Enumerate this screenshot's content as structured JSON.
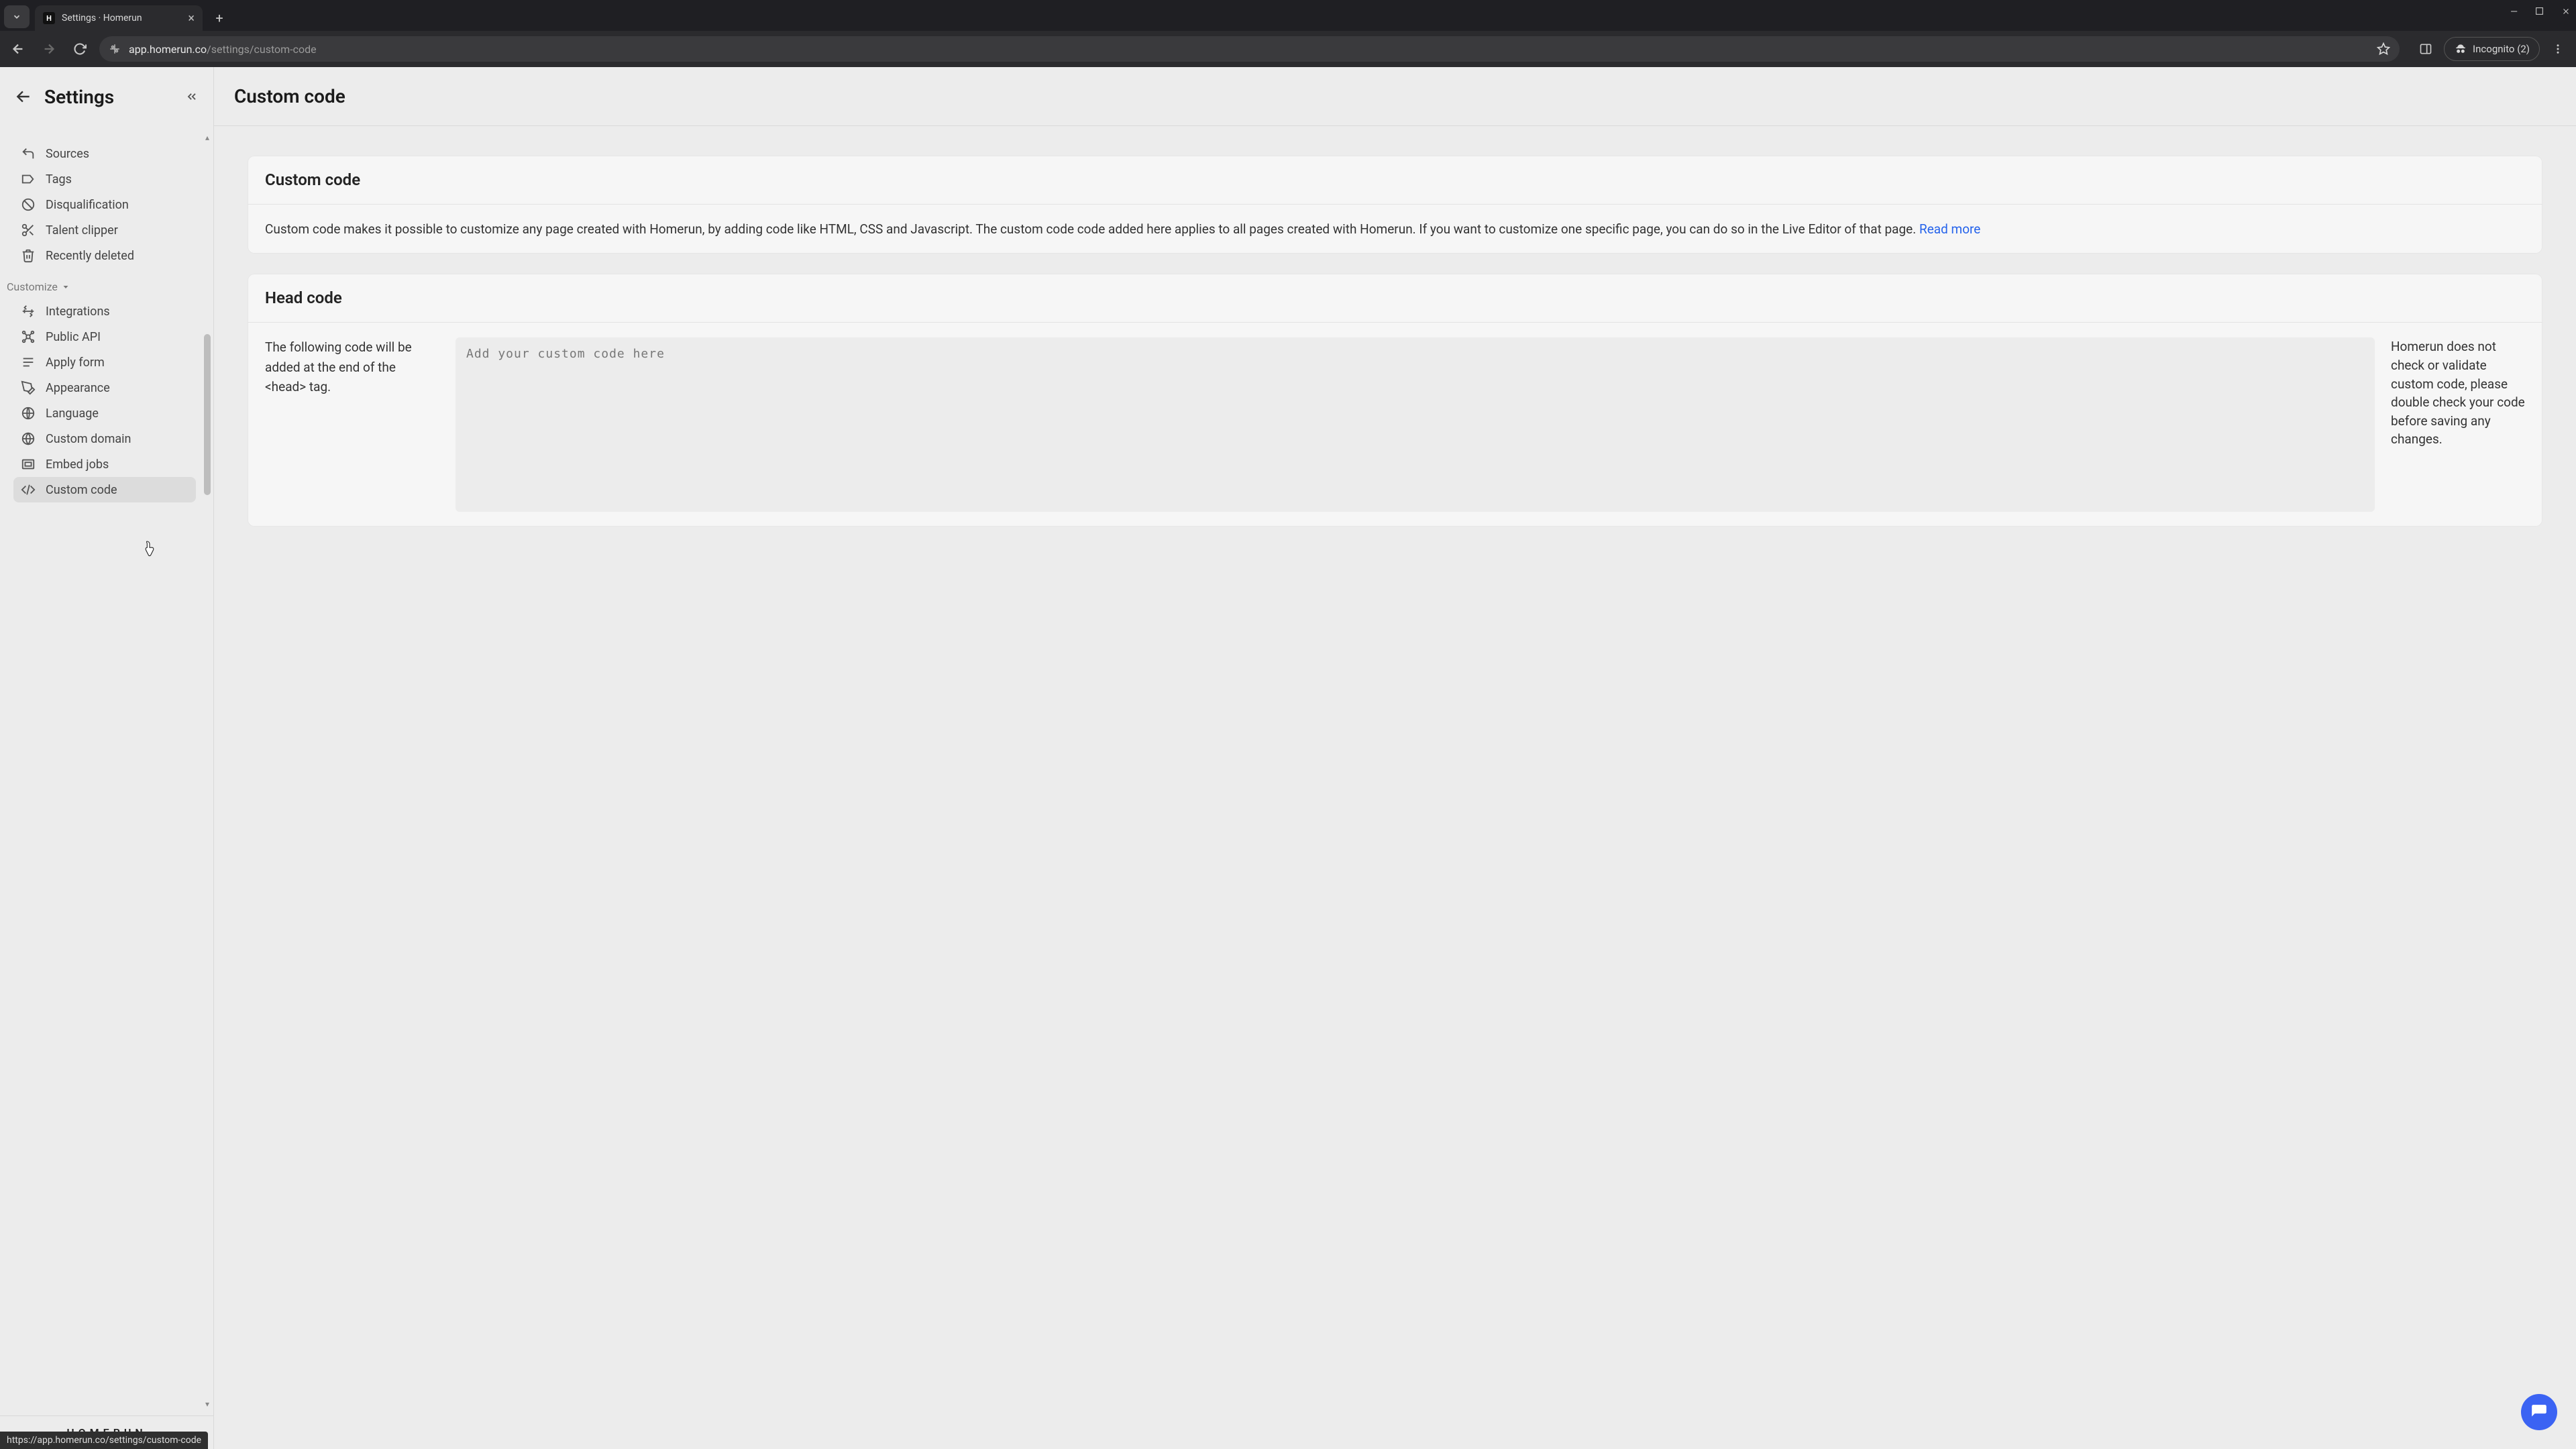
{
  "browser": {
    "tab_title": "Settings · Homerun",
    "url_domain": "app.homerun.co",
    "url_path": "/settings/custom-code",
    "incognito_label": "Incognito (2)",
    "status_url": "https://app.homerun.co/settings/custom-code"
  },
  "sidebar": {
    "title": "Settings",
    "section_label": "Customize",
    "logo_text": "HOMERUN",
    "items_top": [
      {
        "label": "Sources"
      },
      {
        "label": "Tags"
      },
      {
        "label": "Disqualification"
      },
      {
        "label": "Talent clipper"
      },
      {
        "label": "Recently deleted"
      }
    ],
    "items_bottom": [
      {
        "label": "Integrations"
      },
      {
        "label": "Public API"
      },
      {
        "label": "Apply form"
      },
      {
        "label": "Appearance"
      },
      {
        "label": "Language"
      },
      {
        "label": "Custom domain"
      },
      {
        "label": "Embed jobs"
      },
      {
        "label": "Custom code"
      }
    ]
  },
  "main": {
    "title": "Custom code",
    "card1": {
      "heading": "Custom code",
      "body": "Custom code makes it possible to customize any page created with Homerun, by adding code like HTML, CSS and Javascript. The custom code code added here applies to all pages created with Homerun. If you want to customize one specific page, you can do so in the Live Editor of that page. ",
      "link_text": "Read more"
    },
    "card2": {
      "heading": "Head code",
      "left_note": "The following code will be added at the end of the <head> tag.",
      "placeholder": "Add your custom code here",
      "right_note": "Homerun does not check or validate custom code, please double check your code before saving any changes."
    }
  }
}
